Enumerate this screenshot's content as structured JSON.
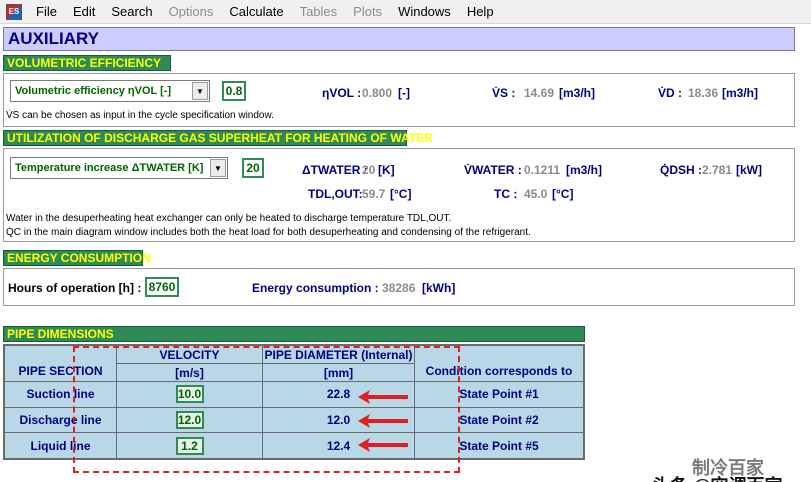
{
  "menu": {
    "items": [
      {
        "label": "File",
        "enabled": true
      },
      {
        "label": "Edit",
        "enabled": true
      },
      {
        "label": "Search",
        "enabled": true
      },
      {
        "label": "Options",
        "enabled": false
      },
      {
        "label": "Calculate",
        "enabled": true
      },
      {
        "label": "Tables",
        "enabled": false
      },
      {
        "label": "Plots",
        "enabled": false
      },
      {
        "label": "Windows",
        "enabled": true
      },
      {
        "label": "Help",
        "enabled": true
      }
    ]
  },
  "title": "AUXILIARY",
  "volumetric": {
    "header": "VOLUMETRIC EFFICIENCY",
    "combo_label": "Volumetric efficiency ηVOL [-]",
    "input_value": "0.8",
    "eta_label": "ηVOL :",
    "eta_value": "0.800",
    "eta_unit": "[-]",
    "vs_label": "V̇S :",
    "vs_value": "14.69",
    "vs_unit": "[m3/h]",
    "vd_label": "V̇D :",
    "vd_value": "18.36",
    "vd_unit": "[m3/h]",
    "note": "V̇S can be chosen as input in the cycle specification window."
  },
  "superheat": {
    "header": "UTILIZATION OF DISCHARGE GAS SUPERHEAT FOR HEATING OF WATER",
    "combo_label": "Temperature increase ΔTWATER [K]",
    "input_value": "20",
    "dt_label": "ΔTWATER :",
    "dt_value": "20",
    "dt_unit": "[K]",
    "vw_label": "V̇WATER :",
    "vw_value": "0.1211",
    "vw_unit": "[m3/h]",
    "qdsh_label": "Q̇DSH :",
    "qdsh_value": "2.781",
    "qdsh_unit": "[kW]",
    "tdl_label": "TDL,OUT:",
    "tdl_value": "59.7",
    "tdl_unit": "[°C]",
    "tc_label": "TC :",
    "tc_value": "45.0",
    "tc_unit": "[°C]",
    "note1": "Water in the desuperheating heat exchanger can only be heated to discharge temperature TDL,OUT.",
    "note2": "Q̇C in the main diagram window includes both the heat load for both desuperheating and condensing of the refrigerant."
  },
  "energy": {
    "header": "ENERGY CONSUMPTION",
    "hours_label": "Hours of operation [h] :",
    "hours_value": "8760",
    "consumption_label": "Energy consumption :",
    "consumption_value": "38286",
    "consumption_unit": "[kWh]"
  },
  "pipe": {
    "header": "PIPE DIMENSIONS",
    "col_section": "PIPE SECTION",
    "col_velocity": "VELOCITY",
    "col_velocity_unit": "[m/s]",
    "col_diameter": "PIPE DIAMETER (Internal)",
    "col_diameter_unit": "[mm]",
    "col_condition": "Condition corresponds to",
    "rows": [
      {
        "section": "Suction line",
        "velocity": "10.0",
        "diameter": "22.8",
        "condition": "State Point #1"
      },
      {
        "section": "Discharge line",
        "velocity": "12.0",
        "diameter": "12.0",
        "condition": "State Point #2"
      },
      {
        "section": "Liquid line",
        "velocity": "1.2",
        "diameter": "12.4",
        "condition": "State Point #5"
      }
    ]
  },
  "watermark": {
    "line1": "制冷百家",
    "line2": "头条 @空调百家"
  },
  "colors": {
    "section_header_bg": "#2e8b57",
    "section_header_text": "#ffff00",
    "label": "#000080",
    "computed_value": "#8a8a8a",
    "input_value": "#006400",
    "title_bg": "#ccccff",
    "table_bg": "#b8d8e8",
    "highlight": "#e02020"
  }
}
